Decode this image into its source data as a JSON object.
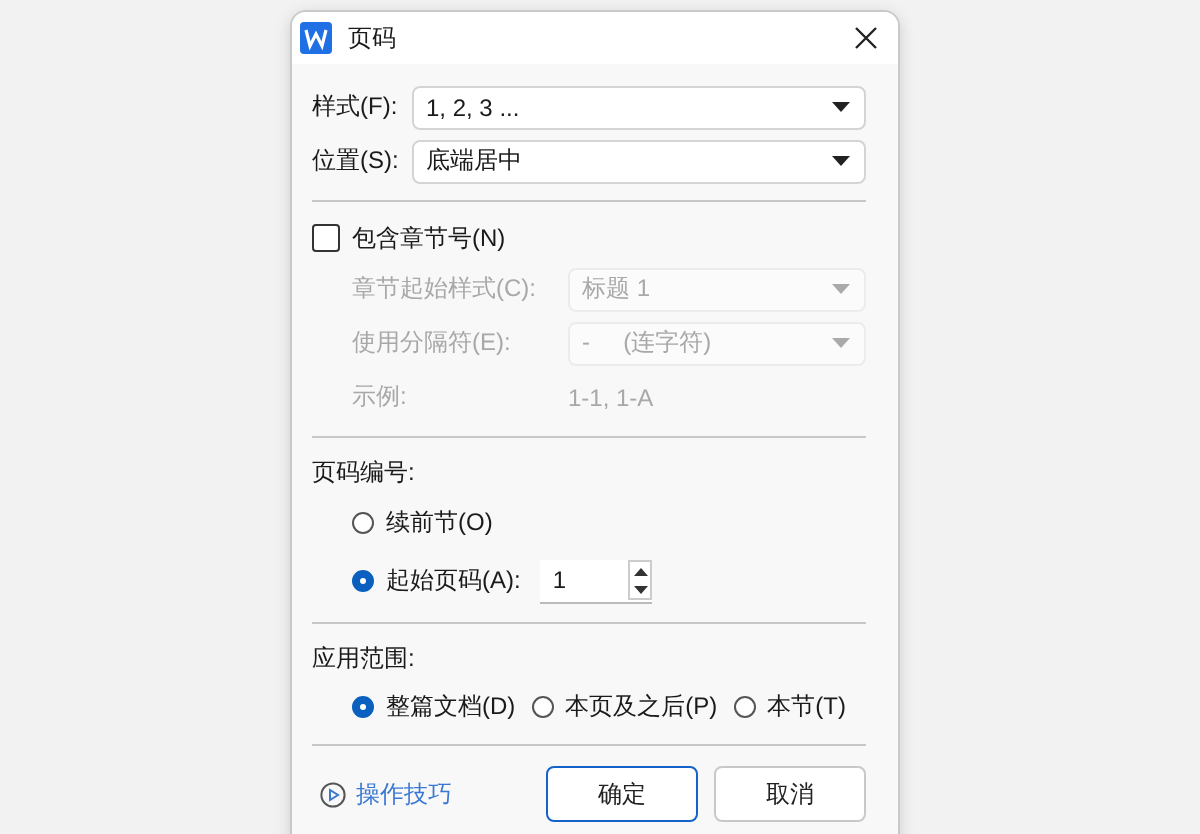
{
  "window": {
    "title": "页码"
  },
  "style_field": {
    "label": "样式(F):",
    "value": "1, 2, 3 ..."
  },
  "position_field": {
    "label": "位置(S):",
    "value": "底端居中"
  },
  "include_chapter": {
    "label": "包含章节号(N)",
    "checked": false
  },
  "chapter_fields": [
    {
      "kind": "select",
      "label": "章节起始样式(C):",
      "value": "标题 1",
      "disabled": true
    },
    {
      "kind": "select",
      "label": "使用分隔符(E):",
      "value": "-     (连字符)",
      "disabled": true
    },
    {
      "kind": "text",
      "label": "示例:",
      "value": "1-1, 1-A",
      "disabled": true
    }
  ],
  "numbering": {
    "heading": "页码编号:",
    "options": [
      {
        "label": "续前节(O)",
        "selected": false
      },
      {
        "label": "起始页码(A):",
        "selected": true
      }
    ],
    "start_value": "1"
  },
  "scope": {
    "heading": "应用范围:",
    "options": [
      {
        "label": "整篇文档(D)",
        "selected": true
      },
      {
        "label": "本页及之后(P)",
        "selected": false
      },
      {
        "label": "本节(T)",
        "selected": false
      }
    ]
  },
  "tips_link": "操作技巧",
  "buttons": [
    {
      "label": "确定",
      "primary": true
    },
    {
      "label": "取消",
      "primary": false
    }
  ]
}
